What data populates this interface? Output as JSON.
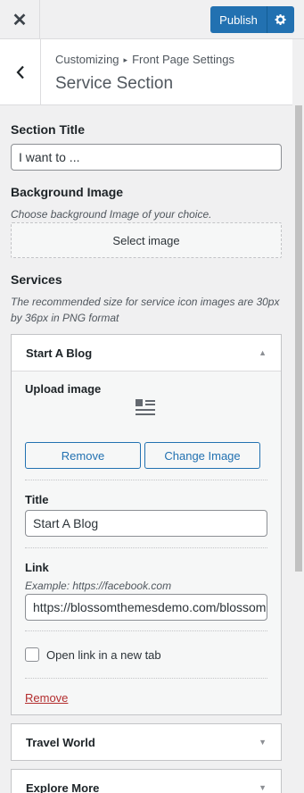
{
  "topbar": {
    "close_label": "✕",
    "publish_label": "Publish",
    "publish_settings_icon": "gear-icon"
  },
  "header": {
    "breadcrumb_root": "Customizing",
    "breadcrumb_sep": "▸",
    "breadcrumb_parent": "Front Page Settings",
    "title": "Service Section"
  },
  "fields": {
    "section_title_label": "Section Title",
    "section_title_value": "I want to ...",
    "bg_label": "Background Image",
    "bg_desc": "Choose background Image of your choice.",
    "bg_select": "Select image",
    "services_label": "Services",
    "services_desc": "The recommended size for service icon images are 30px by 36px in PNG format"
  },
  "services": [
    {
      "title": "Start A Blog",
      "expanded": true,
      "upload_label": "Upload image",
      "remove_btn": "Remove",
      "change_btn": "Change Image",
      "title_label": "Title",
      "title_value": "Start A Blog",
      "link_label": "Link",
      "link_example": "Example: https://facebook.com",
      "link_value": "https://blossomthemesdemo.com/blossom",
      "new_tab_label": "Open link in a new tab",
      "new_tab_checked": false,
      "remove_link": "Remove"
    },
    {
      "title": "Travel World",
      "expanded": false
    },
    {
      "title": "Explore More",
      "expanded": false
    }
  ],
  "colors": {
    "accent": "#2271b1",
    "danger": "#b32d2e"
  }
}
